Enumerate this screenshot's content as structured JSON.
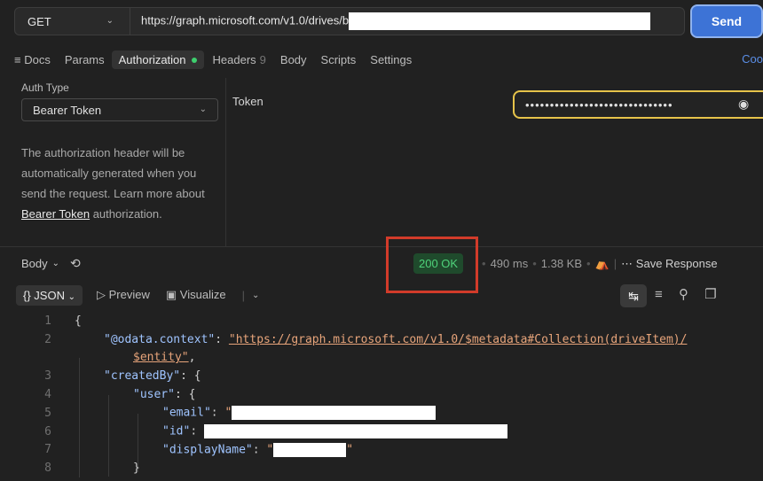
{
  "request": {
    "method": "GET",
    "url": "https://graph.microsoft.com/v1.0/drives/b",
    "send_label": "Send"
  },
  "tabs": {
    "docs": "Docs",
    "params": "Params",
    "authorization": "Authorization",
    "headers": "Headers",
    "headers_count": "9",
    "body": "Body",
    "scripts": "Scripts",
    "settings": "Settings",
    "code": "Coo"
  },
  "auth": {
    "type_label": "Auth Type",
    "type_value": "Bearer Token",
    "description": "The authorization header will be automatically generated when you send the request. Learn more about ",
    "description_link": "Bearer Token",
    "description_tail": " authorization.",
    "token_label": "Token",
    "token_value": "••••••••••••••••••••••••••••••"
  },
  "response": {
    "body_label": "Body",
    "status": "200 OK",
    "time": "490 ms",
    "size": "1.38 KB",
    "save_label": "Save Response",
    "view_json": "JSON",
    "view_preview": "Preview",
    "view_visualize": "Visualize"
  },
  "code": {
    "line_numbers": [
      "1",
      "2",
      "",
      "3",
      "4",
      "5",
      "6",
      "7",
      "8"
    ],
    "brace_open": "{",
    "odata_key": "\"@odata.context\"",
    "odata_value": "\"https://graph.microsoft.com/v1.0/$metadata#Collection(driveItem)/",
    "odata_value_cont": "$entity\"",
    "createdBy_key": "\"createdBy\"",
    "user_key": "\"user\"",
    "email_key": "\"email\"",
    "email_value_start": "\"",
    "id_key": "\"id\"",
    "displayName_key": "\"displayName\"",
    "displayName_value_start": "\"",
    "displayName_value_end": "\"",
    "brace_close": "}"
  },
  "colors": {
    "send": "#3d73d6",
    "status_text": "#4fd27a",
    "highlight_box": "#d23b2a",
    "token_border": "#e6c34a"
  }
}
